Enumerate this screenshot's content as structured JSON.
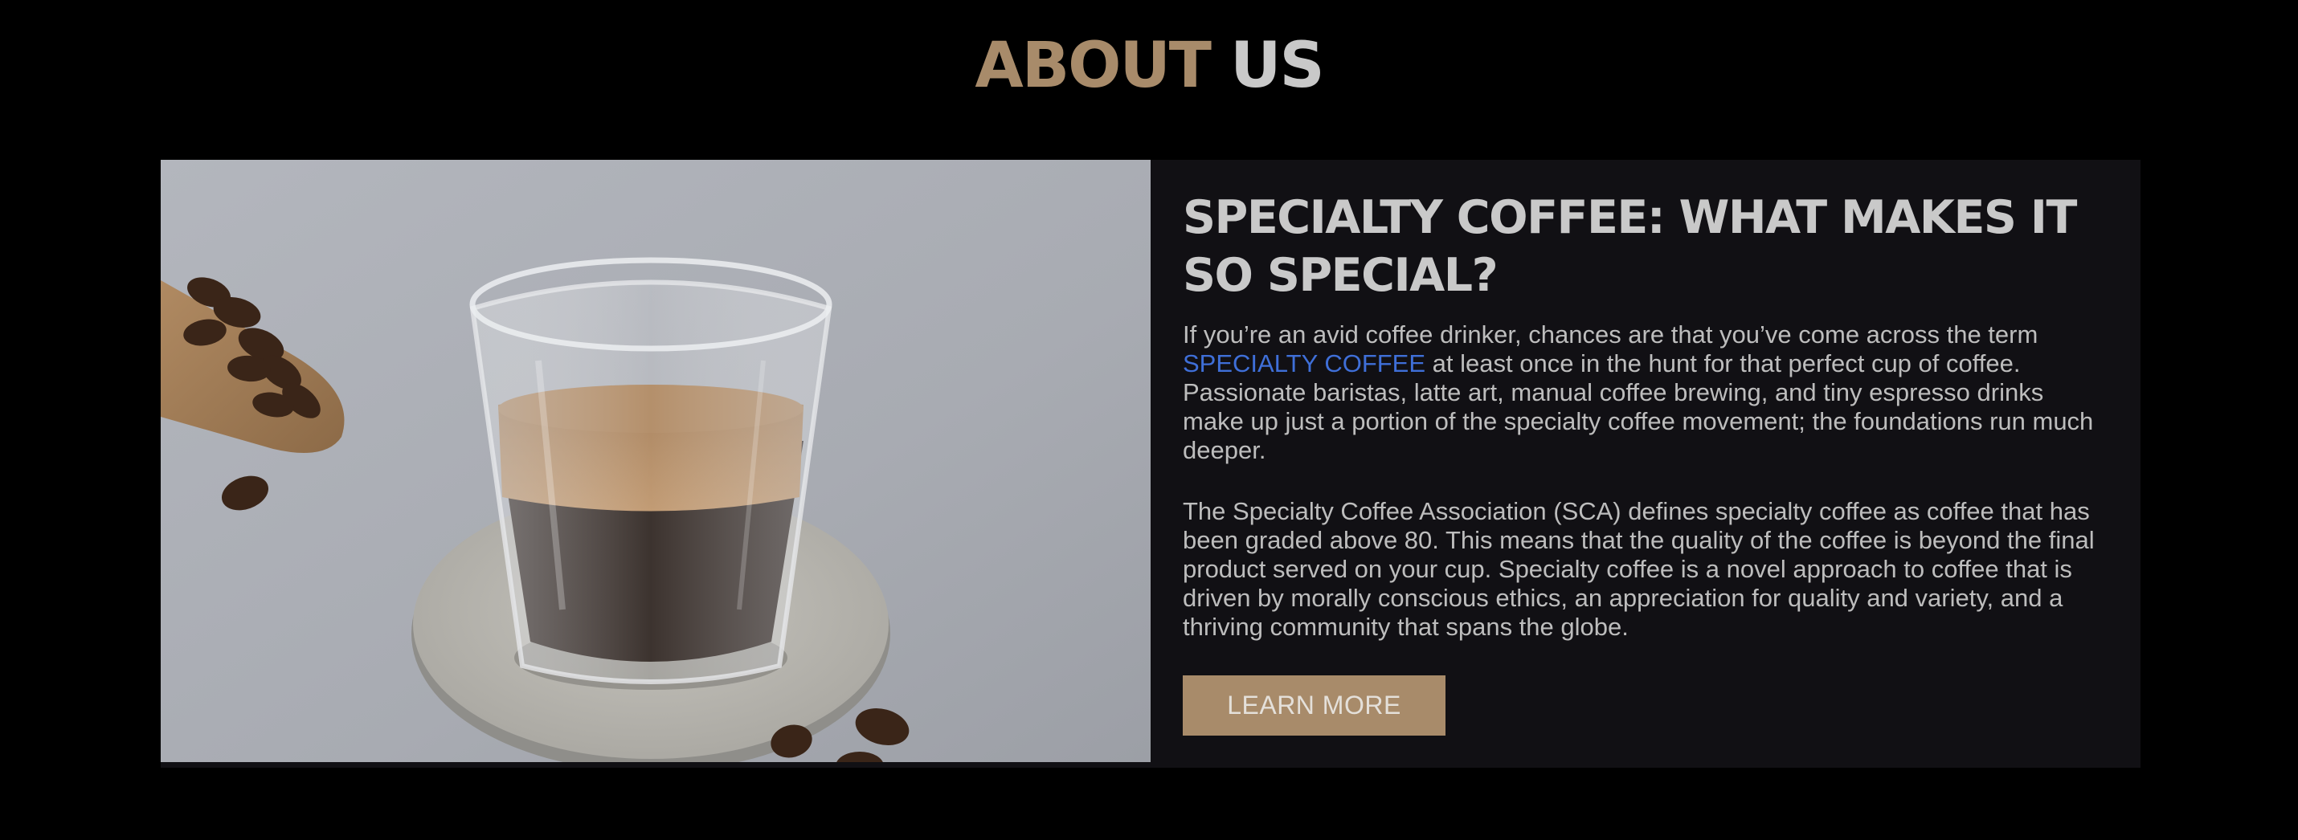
{
  "section": {
    "title_accent": "ABOUT",
    "title_rest": "US"
  },
  "article": {
    "heading": "SPECIALTY COFFEE: WHAT MAKES IT SO SPECIAL?",
    "p1_before": "If you’re an avid coffee drinker, chances are that you’ve come across the term",
    "p1_link": "SPECIALTY COFFEE",
    "p1_after": " at least once in the hunt for that perfect cup of coffee. Passionate baristas, latte art, manual coffee brewing, and tiny espresso drinks make up just a portion of the specialty coffee movement; the foundations run much deeper.",
    "p2": "The Specialty Coffee Association (SCA) defines specialty coffee as coffee that has been graded above 80. This means that the quality of the coffee is beyond the final product served on your cup. Specialty coffee is a novel approach to coffee that is driven by morally conscious ethics, an appreciation for quality and variety, and a thriving community that spans the globe.",
    "button_label": "LEARN MORE"
  },
  "colors": {
    "background": "#000000",
    "card": "#111014",
    "accent": "#a88b6a",
    "link": "#3f6fd8",
    "text": "#bdbdbd"
  },
  "image": {
    "subject": "espresso glass on marble coaster with coffee beans and wooden scoop"
  }
}
